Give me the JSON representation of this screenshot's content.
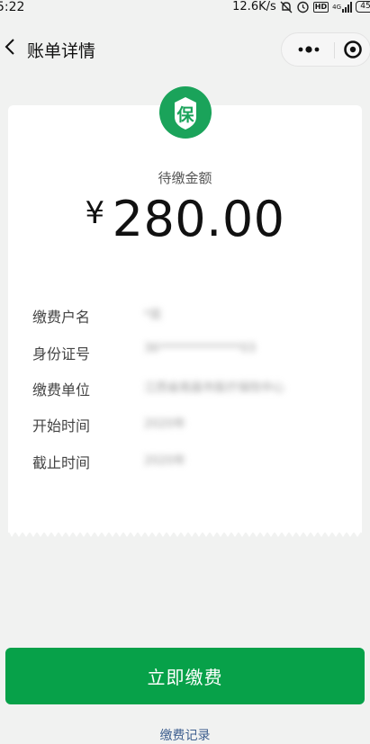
{
  "status_bar": {
    "time": "5:22",
    "net_speed": "12.6K/s",
    "hd_label": "HD",
    "network_label": "4G",
    "battery": "45"
  },
  "nav": {
    "title": "账单详情",
    "back_icon": "back-chevron-icon",
    "more_icon": "more-dots-icon",
    "close_icon": "target-close-icon"
  },
  "badge": {
    "char": "保",
    "color": "#1aa35a"
  },
  "bill": {
    "amount_label": "待缴金额",
    "currency": "¥",
    "amount": "280.00"
  },
  "details": [
    {
      "label": "缴费户名",
      "value": "*奕"
    },
    {
      "label": "身份证号",
      "value": "36**************03"
    },
    {
      "label": "缴费单位",
      "value": "江西省南昌市医疗保险中心"
    },
    {
      "label": "开始时间",
      "value": "2020年"
    },
    {
      "label": "截止时间",
      "value": "2020年"
    }
  ],
  "actions": {
    "pay_label": "立即缴费",
    "records_label": "缴费记录"
  },
  "colors": {
    "accent": "#07a149",
    "link": "#3e5f8f",
    "background": "#f1f2f1"
  }
}
